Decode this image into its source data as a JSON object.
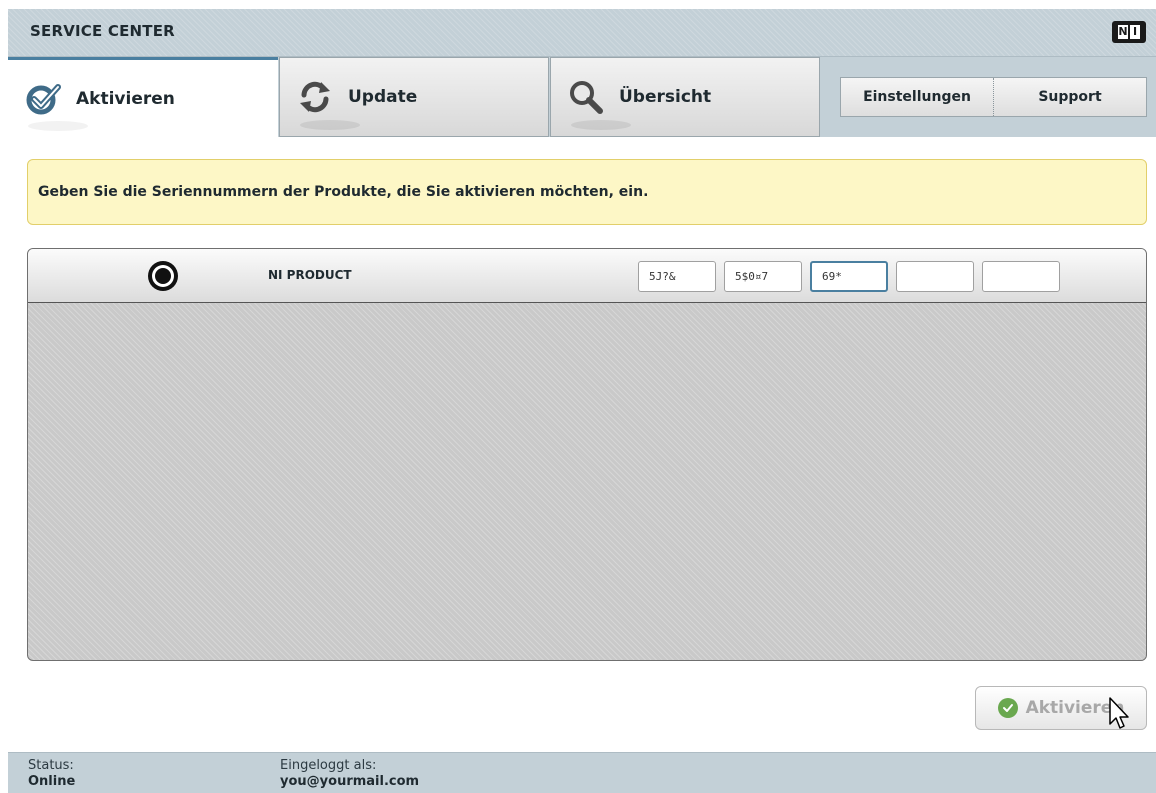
{
  "app": {
    "title": "SERVICE CENTER",
    "logo_text": "NI"
  },
  "tabs": [
    {
      "label": "Aktivieren",
      "icon": "check-icon",
      "active": true
    },
    {
      "label": "Update",
      "icon": "refresh-icon",
      "active": false
    },
    {
      "label": "Übersicht",
      "icon": "search-icon",
      "active": false
    }
  ],
  "header_buttons": {
    "settings_label": "Einstellungen",
    "support_label": "Support"
  },
  "notice": {
    "text": "Geben Sie die Seriennummern der Produkte, die Sie aktivieren möchten, ein."
  },
  "product": {
    "name": "NI PRODUCT",
    "selected": true,
    "serial_fields": [
      "5J?&",
      "5$0¤7",
      "69*",
      "",
      ""
    ]
  },
  "activate_button": {
    "label": "Aktivieren",
    "enabled": false
  },
  "status": {
    "status_label": "Status:",
    "status_value": "Online",
    "login_label": "Eingeloggt als:",
    "login_value": "you@yourmail.com"
  },
  "colors": {
    "accent": "#4a7fa0",
    "chrome": "#c3d0d7",
    "notice_bg": "#fdf7c6",
    "check_green": "#6aa84f"
  }
}
